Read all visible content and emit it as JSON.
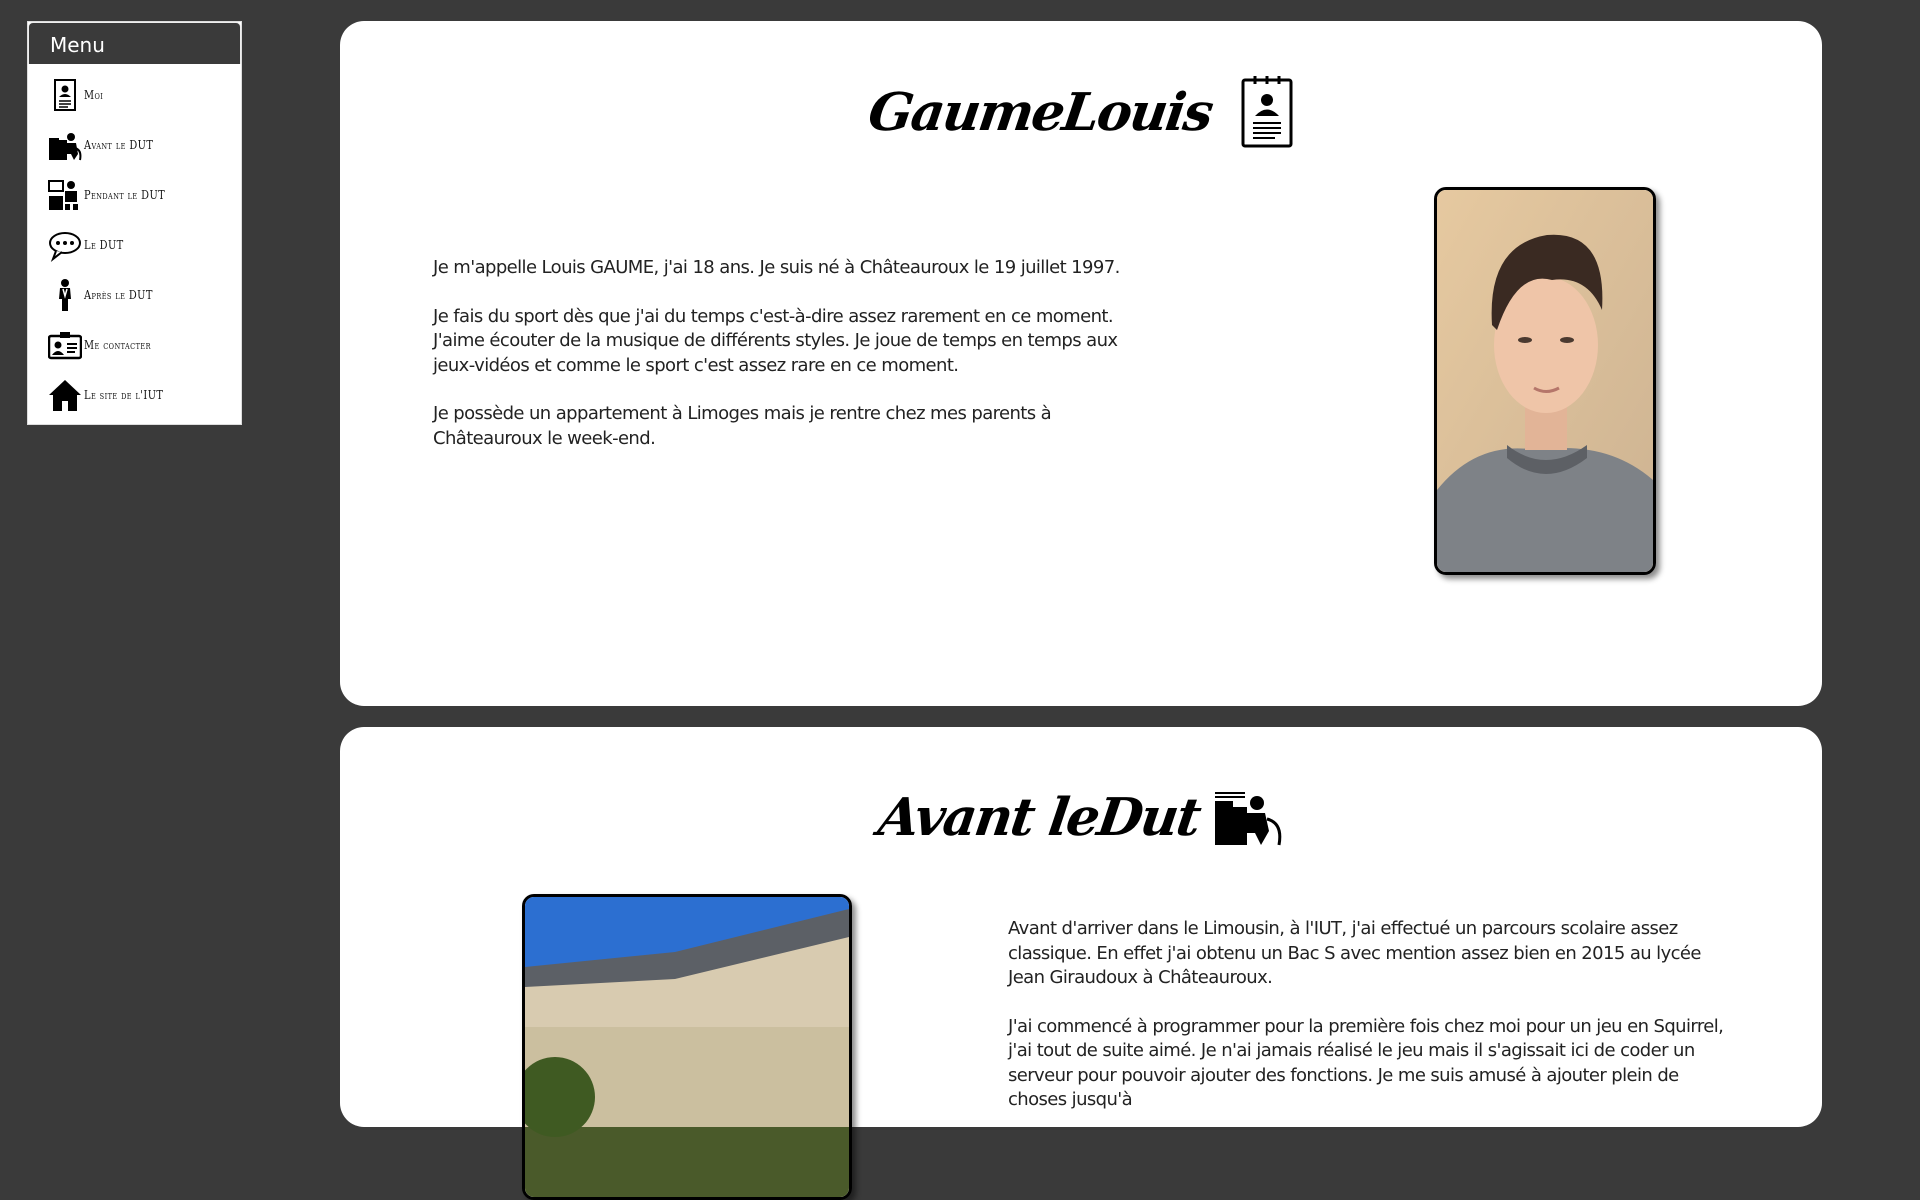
{
  "menu": {
    "title": "Menu",
    "items": [
      {
        "label": "Moi",
        "icon": "resume-icon"
      },
      {
        "label": "Avant le DUT",
        "icon": "student-desk-icon"
      },
      {
        "label": "Pendant le DUT",
        "icon": "classroom-icon"
      },
      {
        "label": "Le DUT",
        "icon": "chat-bubble-icon"
      },
      {
        "label": "Après le DUT",
        "icon": "graduate-person-icon"
      },
      {
        "label": "Me contacter",
        "icon": "contact-card-icon"
      },
      {
        "label": "Le site de l'IUT",
        "icon": "home-icon"
      }
    ]
  },
  "moi": {
    "title": "GaumeLouis",
    "icon": "resume-icon",
    "paragraphs": [
      "Je m'appelle Louis GAUME, j'ai 18 ans. Je suis né à Châteauroux le 19 juillet 1997.",
      "Je fais du sport dès que j'ai du temps c'est-à-dire assez rarement en ce moment. J'aime écouter de la musique de différents styles. Je joue de temps en temps aux jeux-vidéos et comme le sport c'est assez rare en ce moment.",
      "Je possède un appartement à Limoges mais je rentre chez mes parents à Châteauroux le week-end."
    ]
  },
  "avant": {
    "title": "Avant leDut",
    "icon": "student-desk-icon",
    "paragraphs": [
      "Avant d'arriver dans le Limousin, à l'IUT, j'ai effectué un parcours scolaire assez classique. En effet j'ai obtenu un Bac S avec mention assez bien en 2015 au lycée Jean Giraudoux à Châteauroux.",
      "J'ai commencé à programmer pour la première fois chez moi pour un jeu en Squirrel, j'ai tout de suite aimé. Je n'ai jamais réalisé le jeu mais il s'agissait ici de coder un serveur pour pouvoir ajouter des fonctions. Je me suis amusé à ajouter plein de choses jusqu'à"
    ]
  },
  "colors": {
    "background": "#3a3a3a",
    "card": "#ffffff",
    "menu_header": "#3a3a3a"
  }
}
